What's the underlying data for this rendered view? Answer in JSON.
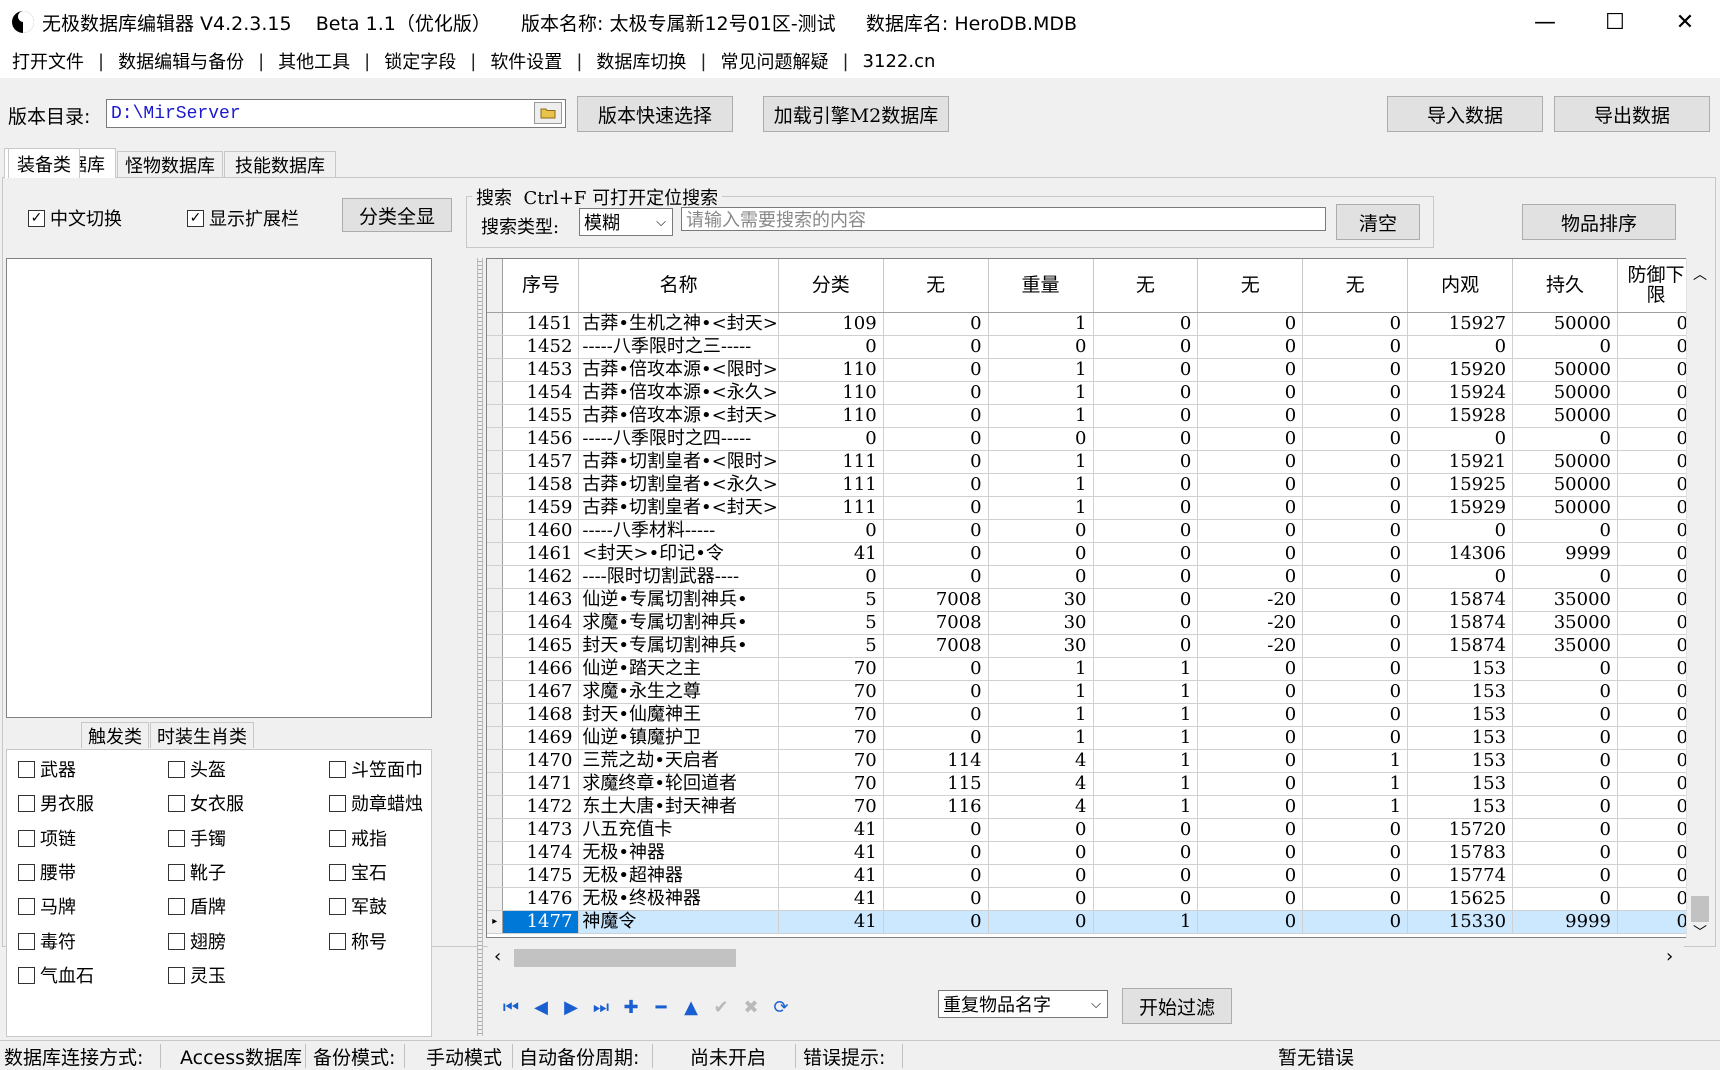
{
  "window": {
    "title": "无极数据库编辑器 V4.2.3.15    Beta 1.1（优化版）     版本名称: 太极专属新12号01区-测试     数据库名: HeroDB.MDB",
    "minimize": "—",
    "maximize": "☐",
    "close": "✕"
  },
  "menu": [
    "打开文件",
    "数据编辑与备份",
    "其他工具",
    "锁定字段",
    "软件设置",
    "数据库切换",
    "常见问题解疑",
    "3122.cn"
  ],
  "toolbar": {
    "dir_label": "版本目录:",
    "dir_value": "D:\\MirServer",
    "quick_select": "版本快速选择",
    "load_engine": "加载引擎M2数据库",
    "import": "导入数据",
    "export": "导出数据"
  },
  "tabs": [
    "物品数据库",
    "怪物数据库",
    "技能数据库"
  ],
  "options": {
    "chinese_switch": "中文切换",
    "show_ext": "显示扩展栏",
    "show_all_cat": "分类全显",
    "search_title": "搜索  Ctrl+F 可打开定位搜索",
    "search_type_label": "搜索类型:",
    "search_type_value": "模糊",
    "search_placeholder": "请输入需要搜索的内容",
    "clear": "清空",
    "sort": "物品排序"
  },
  "category_tabs": [
    "装备类",
    "触发类",
    "时装生肖类"
  ],
  "categories": [
    [
      "武器",
      "头盔",
      "斗笠面巾"
    ],
    [
      "男衣服",
      "女衣服",
      "勋章蜡烛"
    ],
    [
      "项链",
      "手镯",
      "戒指"
    ],
    [
      "腰带",
      "靴子",
      "宝石"
    ],
    [
      "马牌",
      "盾牌",
      "军鼓"
    ],
    [
      "毒符",
      "翅膀",
      "称号"
    ],
    [
      "气血石",
      "灵玉"
    ]
  ],
  "table": {
    "headers": [
      "序号",
      "名称",
      "分类",
      "无",
      "重量",
      "无",
      "无",
      "无",
      "内观",
      "持久",
      "防御下限"
    ],
    "rows": [
      [
        "1451",
        "古莽•生机之神•<封天>",
        "109",
        "0",
        "1",
        "0",
        "0",
        "0",
        "15927",
        "50000",
        "0"
      ],
      [
        "1452",
        "-----八季限时之三-----",
        "0",
        "0",
        "0",
        "0",
        "0",
        "0",
        "0",
        "0",
        "0"
      ],
      [
        "1453",
        "古莽•倍攻本源•<限时>",
        "110",
        "0",
        "1",
        "0",
        "0",
        "0",
        "15920",
        "50000",
        "0"
      ],
      [
        "1454",
        "古莽•倍攻本源•<永久>",
        "110",
        "0",
        "1",
        "0",
        "0",
        "0",
        "15924",
        "50000",
        "0"
      ],
      [
        "1455",
        "古莽•倍攻本源•<封天>",
        "110",
        "0",
        "1",
        "0",
        "0",
        "0",
        "15928",
        "50000",
        "0"
      ],
      [
        "1456",
        "-----八季限时之四-----",
        "0",
        "0",
        "0",
        "0",
        "0",
        "0",
        "0",
        "0",
        "0"
      ],
      [
        "1457",
        "古莽•切割皇者•<限时>",
        "111",
        "0",
        "1",
        "0",
        "0",
        "0",
        "15921",
        "50000",
        "0"
      ],
      [
        "1458",
        "古莽•切割皇者•<永久>",
        "111",
        "0",
        "1",
        "0",
        "0",
        "0",
        "15925",
        "50000",
        "0"
      ],
      [
        "1459",
        "古莽•切割皇者•<封天>",
        "111",
        "0",
        "1",
        "0",
        "0",
        "0",
        "15929",
        "50000",
        "0"
      ],
      [
        "1460",
        "-----八季材料-----",
        "0",
        "0",
        "0",
        "0",
        "0",
        "0",
        "0",
        "0",
        "0"
      ],
      [
        "1461",
        "<封天>•印记•令",
        "41",
        "0",
        "0",
        "0",
        "0",
        "0",
        "14306",
        "9999",
        "0"
      ],
      [
        "1462",
        "----限时切割武器----",
        "0",
        "0",
        "0",
        "0",
        "0",
        "0",
        "0",
        "0",
        "0"
      ],
      [
        "1463",
        "仙逆•专属切割神兵•",
        "5",
        "7008",
        "30",
        "0",
        "-20",
        "0",
        "15874",
        "35000",
        "0"
      ],
      [
        "1464",
        "求魔•专属切割神兵•",
        "5",
        "7008",
        "30",
        "0",
        "-20",
        "0",
        "15874",
        "35000",
        "0"
      ],
      [
        "1465",
        "封天•专属切割神兵•",
        "5",
        "7008",
        "30",
        "0",
        "-20",
        "0",
        "15874",
        "35000",
        "0"
      ],
      [
        "1466",
        "仙逆•踏天之主",
        "70",
        "0",
        "1",
        "1",
        "0",
        "0",
        "153",
        "0",
        "0"
      ],
      [
        "1467",
        "求魔•永生之尊",
        "70",
        "0",
        "1",
        "1",
        "0",
        "0",
        "153",
        "0",
        "0"
      ],
      [
        "1468",
        "封天•仙魔神王",
        "70",
        "0",
        "1",
        "1",
        "0",
        "0",
        "153",
        "0",
        "0"
      ],
      [
        "1469",
        "仙逆•镇魔护卫",
        "70",
        "0",
        "1",
        "1",
        "0",
        "0",
        "153",
        "0",
        "0"
      ],
      [
        "1470",
        "三荒之劫•天启者",
        "70",
        "114",
        "4",
        "1",
        "0",
        "1",
        "153",
        "0",
        "0"
      ],
      [
        "1471",
        "求魔终章•轮回道者",
        "70",
        "115",
        "4",
        "1",
        "0",
        "1",
        "153",
        "0",
        "0"
      ],
      [
        "1472",
        "东土大唐•封天神者",
        "70",
        "116",
        "4",
        "1",
        "0",
        "1",
        "153",
        "0",
        "0"
      ],
      [
        "1473",
        "八五充值卡",
        "41",
        "0",
        "0",
        "0",
        "0",
        "0",
        "15720",
        "0",
        "0"
      ],
      [
        "1474",
        "无极•神器",
        "41",
        "0",
        "0",
        "0",
        "0",
        "0",
        "15783",
        "0",
        "0"
      ],
      [
        "1475",
        "无极•超神器",
        "41",
        "0",
        "0",
        "0",
        "0",
        "0",
        "15774",
        "0",
        "0"
      ],
      [
        "1476",
        "无极•终极神器",
        "41",
        "0",
        "0",
        "0",
        "0",
        "0",
        "15625",
        "0",
        "0"
      ],
      [
        "1477",
        "神魔令",
        "41",
        "0",
        "0",
        "1",
        "0",
        "0",
        "15330",
        "9999",
        "0"
      ]
    ],
    "selected_row": 26
  },
  "bottom": {
    "filter_type": "重复物品名字",
    "start_filter": "开始过滤"
  },
  "status": {
    "conn_label": "数据库连接方式:",
    "conn_value": "Access数据库",
    "backup_label": "备份模式:",
    "backup_value": "手动模式",
    "auto_label": "自动备份周期:",
    "auto_value": "尚未开启",
    "error_label": "错误提示:",
    "error_value": "暂无错误"
  }
}
